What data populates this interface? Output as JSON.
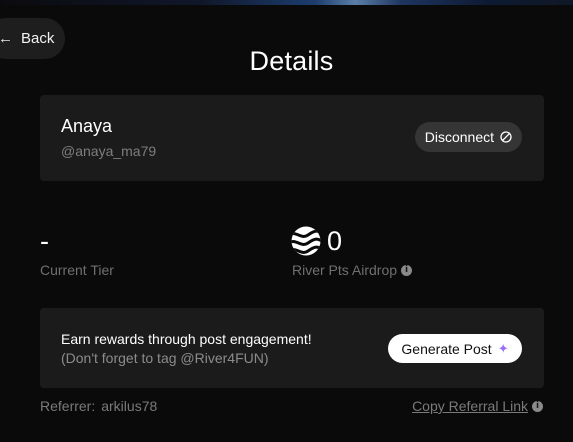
{
  "back": {
    "label": "Back",
    "icon": "arrow-left-icon"
  },
  "page": {
    "title": "Details"
  },
  "account": {
    "name": "Anaya",
    "handle": "@anaya_ma79",
    "disconnect_label": "Disconnect",
    "disconnect_icon": "ban-icon"
  },
  "stats": {
    "tier_value": "-",
    "tier_label": "Current Tier",
    "airdrop_value": "0",
    "airdrop_label": "River Pts Airdrop",
    "airdrop_icon": "river-logo-icon"
  },
  "promo": {
    "title": "Earn rewards through post engagement!",
    "subtitle": "(Don't forget to tag @River4FUN)",
    "button_label": "Generate Post",
    "button_icon": "sparkle-icon"
  },
  "footer": {
    "referrer_label": "Referrer:",
    "referrer_value": "arkilus78",
    "copy_link_label": "Copy Referral Link"
  },
  "colors": {
    "background": "#0a0a0a",
    "card": "#1b1b1b",
    "accent_sparkle": "#9b6ff5"
  }
}
